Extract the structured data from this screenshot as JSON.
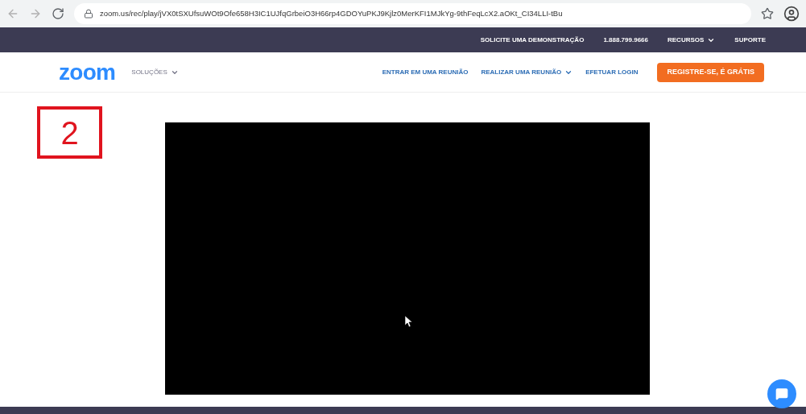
{
  "browser": {
    "url": "zoom.us/rec/play/jVX0tSXUfsuWOt9Ofe658H3IC1UJfqGrbeiO3H66rp4GDOYuPKJ9Kjlz0MerKFI1MJkYg-9thFeqLcX2.aOKt_CI34LLI-tBu"
  },
  "top_bar": {
    "links": [
      {
        "label": "SOLICITE UMA DEMONSTRAÇÃO",
        "dropdown": false
      },
      {
        "label": "1.888.799.9666",
        "dropdown": false
      },
      {
        "label": "RECURSOS",
        "dropdown": true
      },
      {
        "label": "SUPORTE",
        "dropdown": false
      }
    ]
  },
  "header": {
    "logo": "zoom",
    "solutions": {
      "label": "SOLUÇÕES",
      "dropdown": true
    },
    "links": [
      {
        "label": "ENTRAR EM UMA REUNIÃO",
        "dropdown": false
      },
      {
        "label": "REALIZAR UMA REUNIÃO",
        "dropdown": true
      },
      {
        "label": "EFETUAR LOGIN",
        "dropdown": false
      }
    ],
    "signup": "REGISTRE-SE, É GRÁTIS"
  },
  "annotation": {
    "number": "2"
  }
}
